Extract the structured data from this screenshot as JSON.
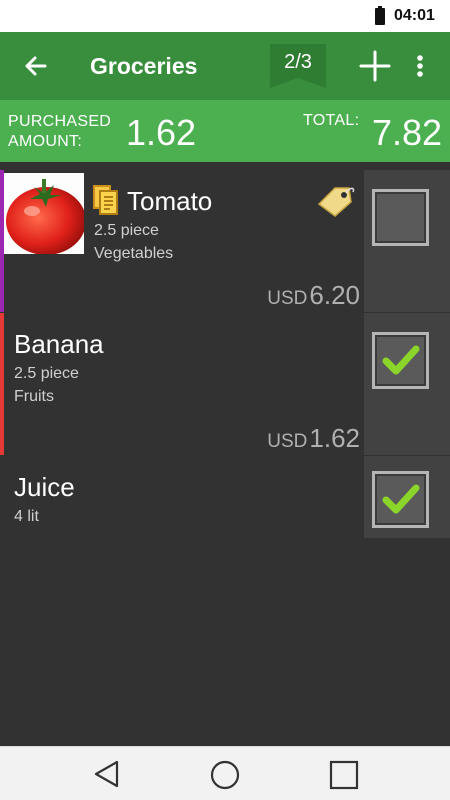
{
  "status_bar": {
    "time": "04:01"
  },
  "toolbar": {
    "title": "Groceries",
    "page_indicator": "2/3",
    "colors": {
      "toolbar": "#388e3c",
      "summary": "#4caf50"
    }
  },
  "summary": {
    "purchased_label_line1": "PURCHASED",
    "purchased_label_line2": "AMOUNT:",
    "purchased_value": "1.62",
    "total_label": "TOTAL:",
    "total_value": "7.82"
  },
  "items": [
    {
      "name": "Tomato",
      "quantity": "2.5 piece",
      "category": "Vegetables",
      "currency": "USD",
      "price": "6.20",
      "checked": false,
      "stripe_color": "#9c27b0",
      "icons": [
        "note-icon",
        "price-tag-icon"
      ]
    },
    {
      "name": "Banana",
      "quantity": "2.5 piece",
      "category": "Fruits",
      "currency": "USD",
      "price": "1.62",
      "checked": true,
      "stripe_color": "#e53935"
    },
    {
      "name": "Juice",
      "quantity": "4 lit",
      "checked": true
    }
  ]
}
